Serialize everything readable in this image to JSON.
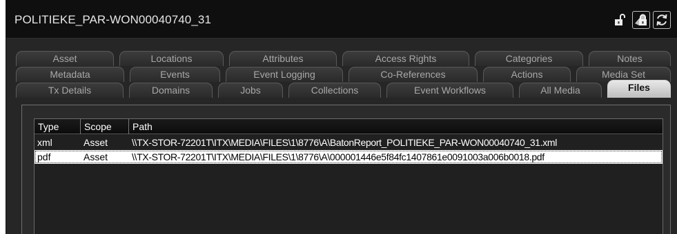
{
  "window": {
    "title": "POLITIEKE_PAR-WON00040740_31",
    "icons": [
      "unlock-icon",
      "lock-icon",
      "refresh-icon"
    ]
  },
  "tabs": {
    "row1": [
      "Asset",
      "Locations",
      "Attributes",
      "Access Rights",
      "Categories",
      "Notes"
    ],
    "row2": [
      "Metadata",
      "Events",
      "Event Logging",
      "Co-References",
      "Actions",
      "Media Set"
    ],
    "row3": [
      "Tx Details",
      "Domains",
      "Jobs",
      "Collections",
      "Event Workflows",
      "All Media",
      "Files"
    ],
    "active": "Files"
  },
  "files_table": {
    "columns": [
      "Type",
      "Scope",
      "Path"
    ],
    "rows": [
      {
        "type": "xml",
        "scope": "Asset",
        "path": "\\\\TX-STOR-72201T\\ITX\\MEDIA\\FILES\\1\\8776\\A\\BatonReport_POLITIEKE_PAR-WON00040740_31.xml",
        "selected": false
      },
      {
        "type": "pdf",
        "scope": "Asset",
        "path": "\\\\TX-STOR-72201T\\ITX\\MEDIA\\FILES\\1\\8776\\A\\000001446e5f84fc1407861e0091003a006b0018.pdf",
        "selected": true
      }
    ]
  },
  "colors": {
    "titlebar_bg": "#0f0f0f",
    "window_bg": "#262626",
    "active_tab": "#d8d8d8",
    "selected_row": "#ffffff"
  }
}
